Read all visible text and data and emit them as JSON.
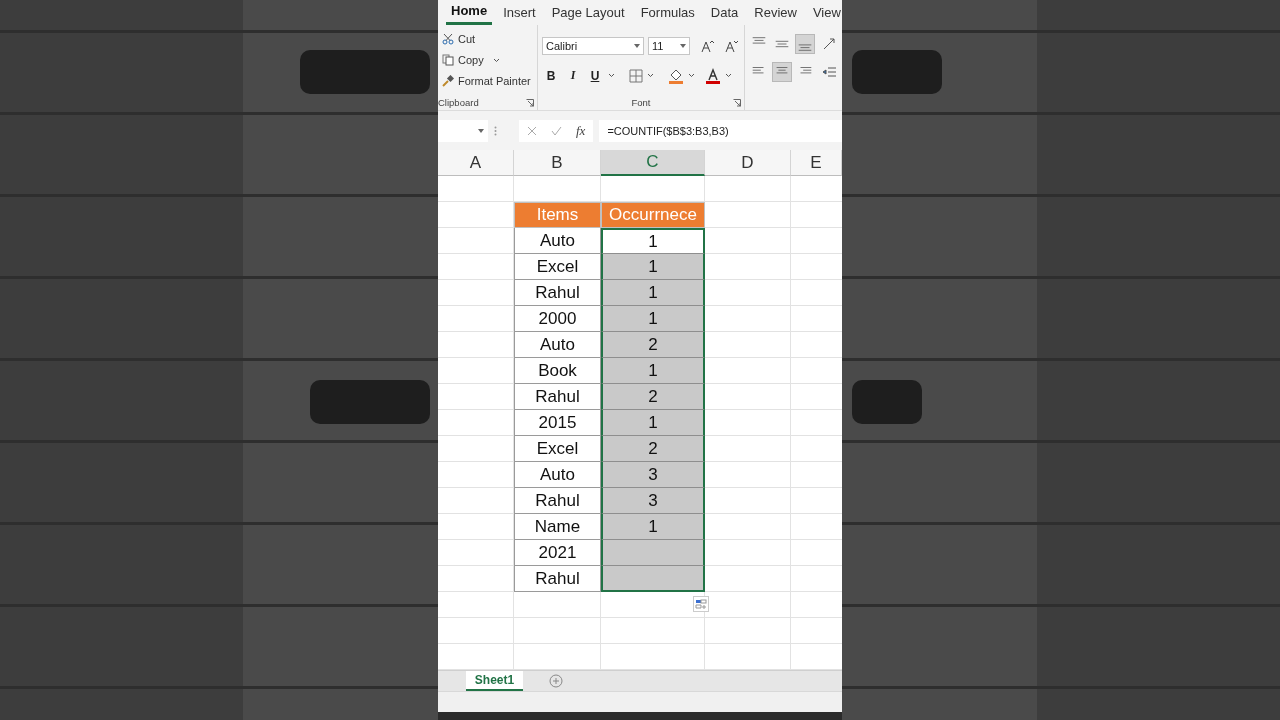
{
  "ribbon_tabs": [
    {
      "label": "Home",
      "selected": true
    },
    {
      "label": "Insert",
      "selected": false
    },
    {
      "label": "Page Layout",
      "selected": false
    },
    {
      "label": "Formulas",
      "selected": false
    },
    {
      "label": "Data",
      "selected": false
    },
    {
      "label": "Review",
      "selected": false
    },
    {
      "label": "View",
      "selected": false
    }
  ],
  "clipboard": {
    "label": "Clipboard",
    "items": [
      {
        "kind": "cut",
        "label": "Cut"
      },
      {
        "kind": "copy",
        "label": "Copy"
      },
      {
        "kind": "painter",
        "label": "Format Painter"
      }
    ]
  },
  "font": {
    "label": "Font",
    "font_name": "Calibri",
    "font_size": "11",
    "styles": [
      "B",
      "I",
      "U"
    ]
  },
  "alignment": {
    "vertical": [
      {
        "selected": false
      },
      {
        "selected": false
      },
      {
        "selected": true
      }
    ],
    "horizontal": [
      {
        "selected": false
      },
      {
        "selected": true
      },
      {
        "selected": false
      }
    ]
  },
  "formula_bar": {
    "fx": "fx",
    "formula": "=COUNTIF($B$3:B3,B3)"
  },
  "sheet": {
    "columns": [
      {
        "label": "A",
        "selected": false
      },
      {
        "label": "B",
        "selected": false
      },
      {
        "label": "C",
        "selected": true
      },
      {
        "label": "D",
        "selected": false
      },
      {
        "label": "E",
        "selected": false
      }
    ],
    "rows": [
      {
        "kind": "header",
        "item": "Items",
        "count": "Occurrnece"
      },
      {
        "kind": "data",
        "item": "Auto",
        "count": "1",
        "selected": true,
        "active": true
      },
      {
        "kind": "data",
        "item": "Excel",
        "count": "1",
        "selected": true,
        "active": false
      },
      {
        "kind": "data",
        "item": "Rahul",
        "count": "1",
        "selected": true,
        "active": false
      },
      {
        "kind": "data",
        "item": "2000",
        "count": "1",
        "selected": true,
        "active": false
      },
      {
        "kind": "data",
        "item": "Auto",
        "count": "2",
        "selected": true,
        "active": false
      },
      {
        "kind": "data",
        "item": "Book",
        "count": "1",
        "selected": true,
        "active": false
      },
      {
        "kind": "data",
        "item": "Rahul",
        "count": "2",
        "selected": true,
        "active": false
      },
      {
        "kind": "data",
        "item": "2015",
        "count": "1",
        "selected": true,
        "active": false
      },
      {
        "kind": "data",
        "item": "Excel",
        "count": "2",
        "selected": true,
        "active": false
      },
      {
        "kind": "data",
        "item": "Auto",
        "count": "3",
        "selected": true,
        "active": false
      },
      {
        "kind": "data",
        "item": "Rahul",
        "count": "3",
        "selected": true,
        "active": false
      },
      {
        "kind": "data",
        "item": "Name",
        "count": "1",
        "selected": true,
        "active": false
      },
      {
        "kind": "data",
        "item": "2021",
        "selected": true,
        "active": false
      },
      {
        "kind": "data",
        "item": "Rahul",
        "selected": true,
        "active": false
      }
    ]
  },
  "sheet_tabs": [
    {
      "label": "Sheet1",
      "selected": true
    }
  ]
}
